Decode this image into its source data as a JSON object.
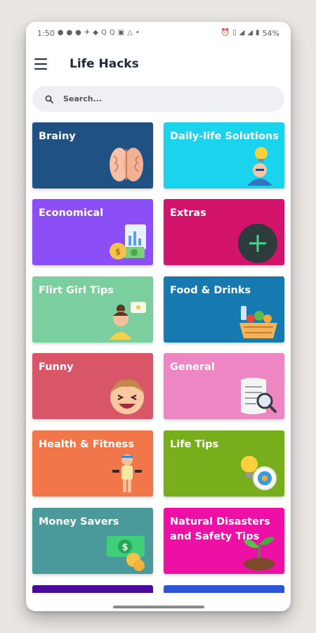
{
  "status_bar": {
    "time": "1:50",
    "battery": "54%",
    "left_icons": [
      "facebook-icon",
      "facebook-icon",
      "pinterest-icon",
      "flight-icon",
      "cat-icon",
      "q-icon",
      "q-icon",
      "chat-icon",
      "warning-icon",
      "dot-icon"
    ],
    "right_icons": [
      "alarm-icon",
      "vibrate-icon",
      "signal-icon",
      "signal-icon",
      "battery-icon"
    ]
  },
  "toolbar": {
    "title": "Life Hacks",
    "menu_icon": "hamburger-menu-icon"
  },
  "search": {
    "placeholder": "Search...",
    "icon": "search-icon"
  },
  "categories": [
    {
      "label": "Brainy",
      "color": "#1f5182",
      "icon": "brain-icon"
    },
    {
      "label": "Daily-life Solutions",
      "color": "#1ad3ec",
      "icon": "idea-person-icon"
    },
    {
      "label": "Economical",
      "color": "#8c4ef6",
      "icon": "money-chart-icon"
    },
    {
      "label": "Extras",
      "color": "#d2126b",
      "icon": "plus-icon"
    },
    {
      "label": "Flirt Girl Tips",
      "color": "#7bcf9e",
      "icon": "girl-chat-icon"
    },
    {
      "label": "Food & Drinks",
      "color": "#167ab1",
      "icon": "food-basket-icon"
    },
    {
      "label": "Funny",
      "color": "#d85668",
      "icon": "laughing-face-icon"
    },
    {
      "label": "General",
      "color": "#ef86c4",
      "icon": "document-search-icon"
    },
    {
      "label": "Health & Fitness",
      "color": "#f1774a",
      "icon": "dumbbell-man-icon"
    },
    {
      "label": "Life Tips",
      "color": "#78ad1c",
      "icon": "bulb-target-icon"
    },
    {
      "label": "Money Savers",
      "color": "#4a9a9b",
      "icon": "cash-coins-icon"
    },
    {
      "label": "Natural Disasters and Safety Tips",
      "color": "#ee0fa4",
      "icon": "plant-soil-icon"
    }
  ],
  "partial_cards": [
    {
      "color": "#4a0a9a"
    },
    {
      "color": "#2b55d6"
    }
  ]
}
